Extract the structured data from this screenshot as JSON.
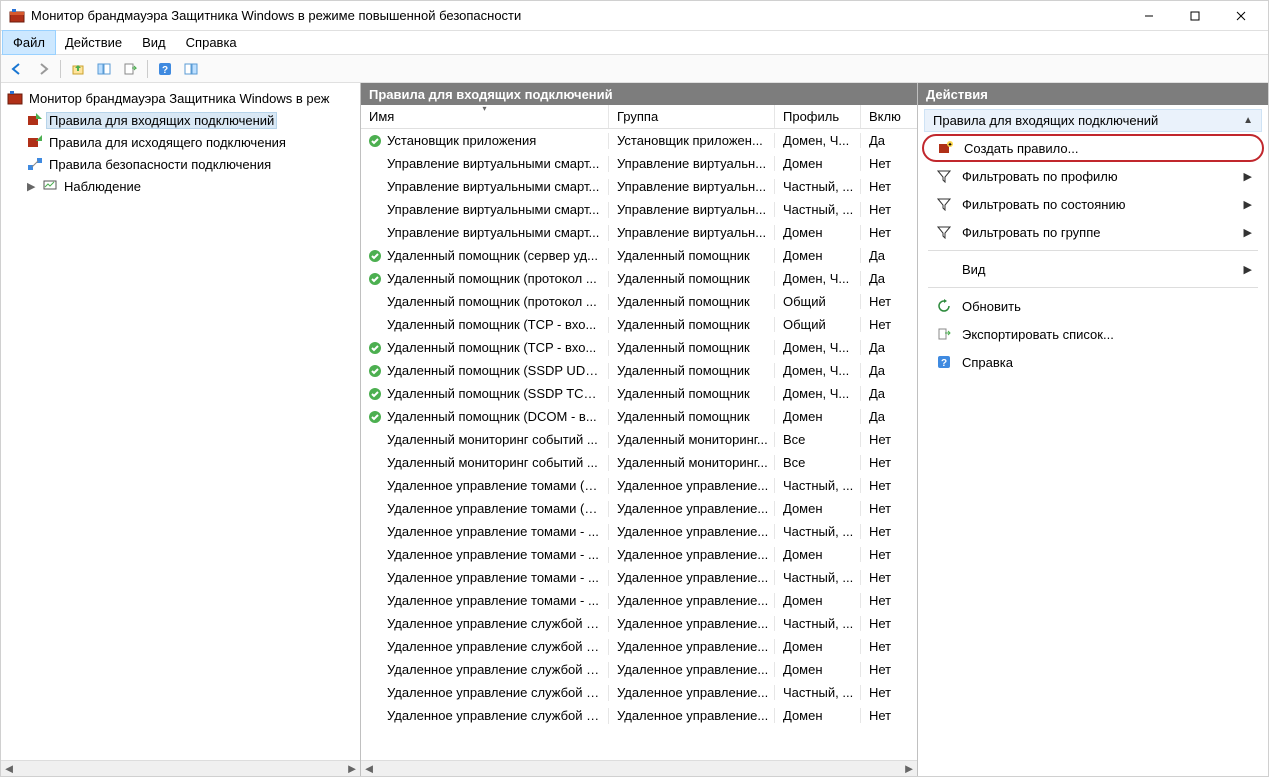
{
  "window": {
    "title": "Монитор брандмауэра Защитника Windows в режиме повышенной безопасности"
  },
  "menu": {
    "file": "Файл",
    "action": "Действие",
    "view": "Вид",
    "help": "Справка"
  },
  "tree": {
    "root": "Монитор брандмауэра Защитника Windows в реж",
    "items": [
      "Правила для входящих подключений",
      "Правила для исходящего подключения",
      "Правила безопасности подключения",
      "Наблюдение"
    ]
  },
  "center": {
    "header": "Правила для входящих подключений",
    "columns": {
      "name": "Имя",
      "group": "Группа",
      "profile": "Профиль",
      "enabled": "Вклю"
    },
    "rows": [
      {
        "enabled": true,
        "name": "Установщик приложения",
        "group": "Установщик приложен...",
        "profile": "Домен, Ч...",
        "en": "Да"
      },
      {
        "enabled": false,
        "name": "Управление виртуальными смарт...",
        "group": "Управление виртуальн...",
        "profile": "Домен",
        "en": "Нет"
      },
      {
        "enabled": false,
        "name": "Управление виртуальными смарт...",
        "group": "Управление виртуальн...",
        "profile": "Частный, ...",
        "en": "Нет"
      },
      {
        "enabled": false,
        "name": "Управление виртуальными смарт...",
        "group": "Управление виртуальн...",
        "profile": "Частный, ...",
        "en": "Нет"
      },
      {
        "enabled": false,
        "name": "Управление виртуальными смарт...",
        "group": "Управление виртуальн...",
        "profile": "Домен",
        "en": "Нет"
      },
      {
        "enabled": true,
        "name": "Удаленный помощник (сервер уд...",
        "group": "Удаленный помощник",
        "profile": "Домен",
        "en": "Да"
      },
      {
        "enabled": true,
        "name": "Удаленный помощник (протокол ...",
        "group": "Удаленный помощник",
        "profile": "Домен, Ч...",
        "en": "Да"
      },
      {
        "enabled": false,
        "name": "Удаленный помощник (протокол ...",
        "group": "Удаленный помощник",
        "profile": "Общий",
        "en": "Нет"
      },
      {
        "enabled": false,
        "name": "Удаленный помощник (TCP - вхо...",
        "group": "Удаленный помощник",
        "profile": "Общий",
        "en": "Нет"
      },
      {
        "enabled": true,
        "name": "Удаленный помощник (TCP - вхо...",
        "group": "Удаленный помощник",
        "profile": "Домен, Ч...",
        "en": "Да"
      },
      {
        "enabled": true,
        "name": "Удаленный помощник (SSDP UDP...",
        "group": "Удаленный помощник",
        "profile": "Домен, Ч...",
        "en": "Да"
      },
      {
        "enabled": true,
        "name": "Удаленный помощник (SSDP TCP ...",
        "group": "Удаленный помощник",
        "profile": "Домен, Ч...",
        "en": "Да"
      },
      {
        "enabled": true,
        "name": "Удаленный помощник (DCOM - в...",
        "group": "Удаленный помощник",
        "profile": "Домен",
        "en": "Да"
      },
      {
        "enabled": false,
        "name": "Удаленный мониторинг событий ...",
        "group": "Удаленный мониторинг...",
        "profile": "Все",
        "en": "Нет"
      },
      {
        "enabled": false,
        "name": "Удаленный мониторинг событий ...",
        "group": "Удаленный мониторинг...",
        "profile": "Все",
        "en": "Нет"
      },
      {
        "enabled": false,
        "name": "Удаленное управление томами (R...",
        "group": "Удаленное управление...",
        "profile": "Частный, ...",
        "en": "Нет"
      },
      {
        "enabled": false,
        "name": "Удаленное управление томами (R...",
        "group": "Удаленное управление...",
        "profile": "Домен",
        "en": "Нет"
      },
      {
        "enabled": false,
        "name": "Удаленное управление томами - ...",
        "group": "Удаленное управление...",
        "profile": "Частный, ...",
        "en": "Нет"
      },
      {
        "enabled": false,
        "name": "Удаленное управление томами - ...",
        "group": "Удаленное управление...",
        "profile": "Домен",
        "en": "Нет"
      },
      {
        "enabled": false,
        "name": "Удаленное управление томами - ...",
        "group": "Удаленное управление...",
        "profile": "Частный, ...",
        "en": "Нет"
      },
      {
        "enabled": false,
        "name": "Удаленное управление томами - ...",
        "group": "Удаленное управление...",
        "profile": "Домен",
        "en": "Нет"
      },
      {
        "enabled": false,
        "name": "Удаленное управление службой (...",
        "group": "Удаленное управление...",
        "profile": "Частный, ...",
        "en": "Нет"
      },
      {
        "enabled": false,
        "name": "Удаленное управление службой (...",
        "group": "Удаленное управление...",
        "profile": "Домен",
        "en": "Нет"
      },
      {
        "enabled": false,
        "name": "Удаленное управление службой (...",
        "group": "Удаленное управление...",
        "profile": "Домен",
        "en": "Нет"
      },
      {
        "enabled": false,
        "name": "Удаленное управление службой (...",
        "group": "Удаленное управление...",
        "profile": "Частный, ...",
        "en": "Нет"
      },
      {
        "enabled": false,
        "name": "Удаленное управление службой (...",
        "group": "Удаленное управление...",
        "profile": "Домен",
        "en": "Нет"
      }
    ]
  },
  "actions": {
    "header": "Действия",
    "group_label": "Правила для входящих подключений",
    "items": {
      "new_rule": "Создать правило...",
      "filter_profile": "Фильтровать по профилю",
      "filter_state": "Фильтровать по состоянию",
      "filter_group": "Фильтровать по группе",
      "view": "Вид",
      "refresh": "Обновить",
      "export": "Экспортировать список...",
      "help": "Справка"
    }
  }
}
